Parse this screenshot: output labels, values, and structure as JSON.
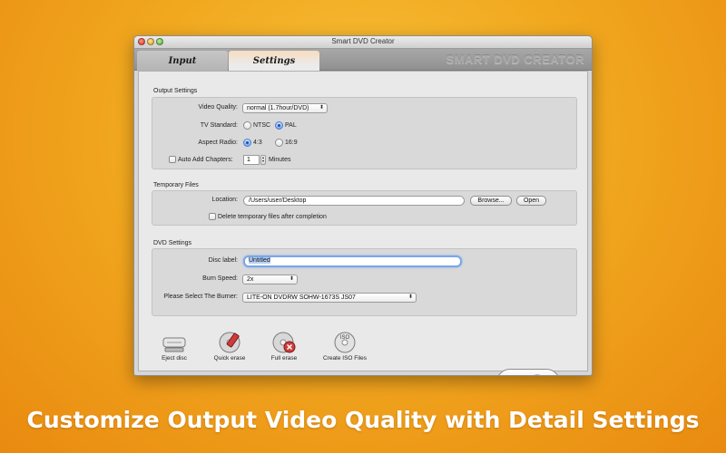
{
  "window": {
    "title": "Smart DVD Creator",
    "brand": "SMART DVD CREATOR"
  },
  "tabs": [
    {
      "label": "Input"
    },
    {
      "label": "Settings"
    }
  ],
  "output_settings": {
    "title": "Output Settings",
    "video_quality_label": "Video Quality:",
    "video_quality_value": "normal (1.7hour/DVD)",
    "tv_standard_label": "TV Standard:",
    "tv_options": [
      "NTSC",
      "PAL"
    ],
    "tv_selected": "PAL",
    "aspect_label": "Aspect Radio:",
    "aspect_options": [
      "4:3",
      "16:9"
    ],
    "aspect_selected": "4:3",
    "auto_chapters_label": "Auto Add Chapters:",
    "auto_chapters_value": "1",
    "minutes_label": "Minutes"
  },
  "temporary_files": {
    "title": "Temporary Files",
    "location_label": "Location:",
    "location_value": "/Users/user/Desktop",
    "browse_label": "Browse...",
    "open_label": "Open",
    "delete_label": "Delete temporary files after completion"
  },
  "dvd_settings": {
    "title": "DVD Settings",
    "disc_label_label": "Disc label:",
    "disc_label_value": "Untitled",
    "burn_speed_label": "Burn Speed:",
    "burn_speed_value": "2x",
    "burner_label": "Please Select The Burner:",
    "burner_value": "LITE-ON  DVDRW SOHW-1673S  JS07"
  },
  "toolbar": {
    "eject": "Eject disc",
    "quick_erase": "Quick erase",
    "full_erase": "Full erase",
    "create_iso": "Create ISO Files",
    "iso_badge": "ISO"
  },
  "caption": "Customize Output Video Quality with Detail Settings",
  "colors": {
    "accent": "#4a7bd0",
    "background": "#f1a81f",
    "flame": "#e8561a"
  }
}
